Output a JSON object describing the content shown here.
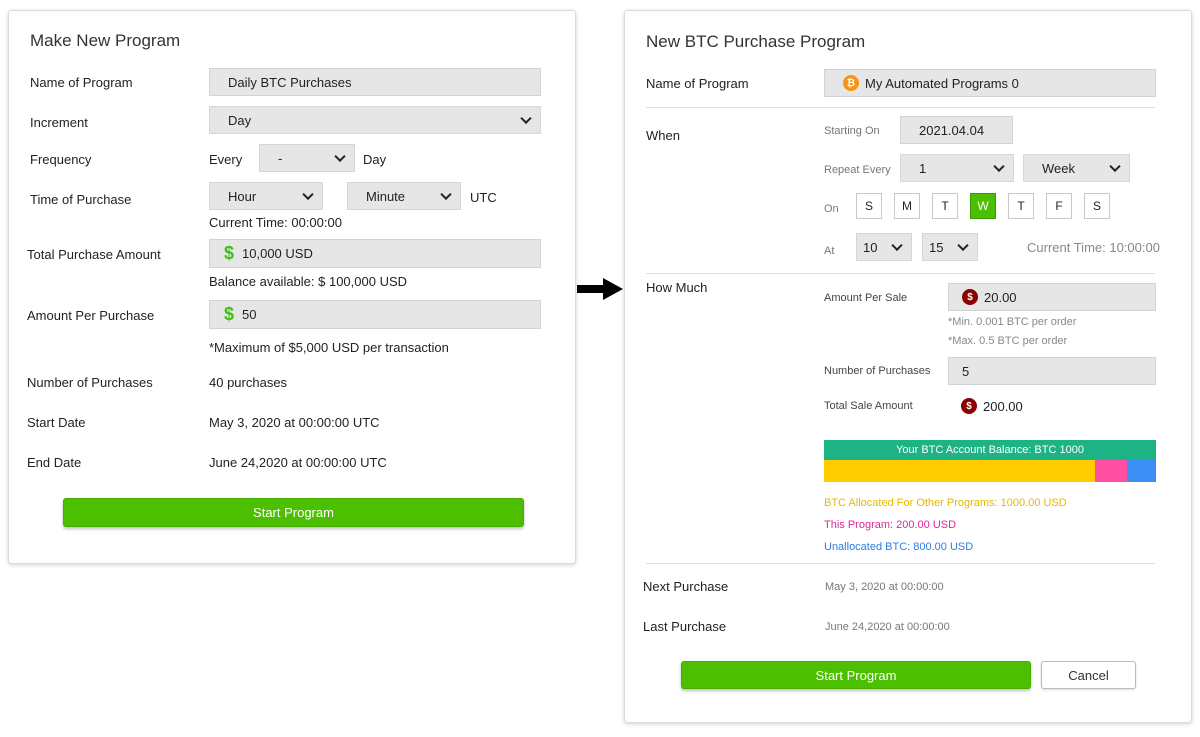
{
  "left": {
    "title": "Make New Program",
    "name_label": "Name of Program",
    "name_value": "Daily BTC Purchases",
    "increment_label": "Increment",
    "increment_value": "Day",
    "frequency_label": "Frequency",
    "frequency_every": "Every",
    "frequency_value": "-",
    "frequency_unit": "Day",
    "time_label": "Time of Purchase",
    "hour_value": "Hour",
    "minute_value": "Minute",
    "tz": "UTC",
    "current_time": "Current Time: 00:00:00",
    "total_label": "Total Purchase Amount",
    "total_value": "10,000 USD",
    "balance": "Balance available: $ 100,000 USD",
    "per_label": "Amount Per Purchase",
    "per_value": "50",
    "max_note": "*Maximum of $5,000 USD per transaction",
    "num_label": "Number of Purchases",
    "num_value": "40 purchases",
    "start_label": "Start Date",
    "start_value": "May 3, 2020 at 00:00:00 UTC",
    "end_label": "End Date",
    "end_value": "June 24,2020 at 00:00:00 UTC",
    "start_button": "Start Program",
    "dollar_icon": "$"
  },
  "right": {
    "title": "New BTC Purchase Program",
    "name_label": "Name of Program",
    "name_value": "My Automated Programs 0",
    "btc_icon": "₿",
    "when_label": "When",
    "starting_label": "Starting On",
    "starting_value": "2021.04.04",
    "repeat_label": "Repeat Every",
    "repeat_value": "1",
    "repeat_unit": "Week",
    "on_label": "On",
    "days": [
      "S",
      "M",
      "T",
      "W",
      "T",
      "F",
      "S"
    ],
    "selected_day_index": 3,
    "at_label": "At",
    "hour_value": "10",
    "minute_value": "15",
    "current_time": "Current Time: 10:00:00",
    "how_much_label": "How Much",
    "per_sale_label": "Amount Per Sale",
    "per_sale_value": "20.00",
    "min_note": "*Min. 0.001 BTC per order",
    "max_note": "*Max. 0.5 BTC per order",
    "num_label": "Number of Purchases",
    "num_value": "5",
    "total_label": "Total Sale Amount",
    "total_value": "200.00",
    "usd_icon": "$",
    "balance_bar": {
      "label": "Your BTC Account Balance: BTC 1000",
      "header_color": "#1db385",
      "segments": [
        {
          "name": "other",
          "fraction": 0.8163,
          "color": "#ffcc00"
        },
        {
          "name": "this",
          "fraction": 0.0952,
          "color": "#ff4fa3"
        },
        {
          "name": "unallocated",
          "fraction": 0.0885,
          "color": "#3d8ff5"
        }
      ]
    },
    "legend_other": "BTC Allocated For Other Programs: 1000.00 USD",
    "legend_this": "This Program: 200.00 USD",
    "legend_unalloc": "Unallocated BTC: 800.00 USD",
    "next_label": "Next Purchase",
    "next_value": "May 3, 2020 at 00:00:00",
    "last_label": "Last Purchase",
    "last_value": "June 24,2020 at 00:00:00",
    "start_button": "Start Program",
    "cancel_button": "Cancel"
  },
  "colors": {
    "accent_green": "#4cbf00",
    "legend_other": "#e6b800",
    "legend_this": "#e0289a",
    "legend_unalloc": "#2d7de0"
  }
}
